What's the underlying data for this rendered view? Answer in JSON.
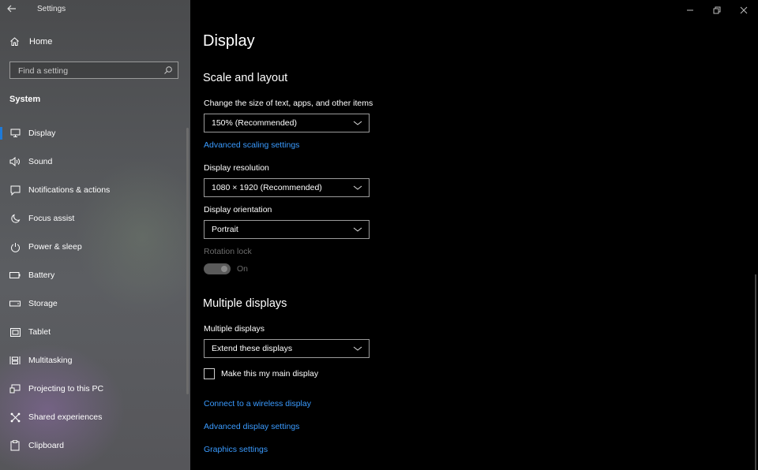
{
  "window": {
    "title": "Settings"
  },
  "sidebar": {
    "home_label": "Home",
    "search_placeholder": "Find a setting",
    "section": "System",
    "items": [
      {
        "label": "Display",
        "icon": "monitor-icon"
      },
      {
        "label": "Sound",
        "icon": "speaker-icon"
      },
      {
        "label": "Notifications & actions",
        "icon": "notification-icon"
      },
      {
        "label": "Focus assist",
        "icon": "moon-icon"
      },
      {
        "label": "Power & sleep",
        "icon": "power-icon"
      },
      {
        "label": "Battery",
        "icon": "battery-icon"
      },
      {
        "label": "Storage",
        "icon": "storage-icon"
      },
      {
        "label": "Tablet",
        "icon": "tablet-icon"
      },
      {
        "label": "Multitasking",
        "icon": "multitasking-icon"
      },
      {
        "label": "Projecting to this PC",
        "icon": "projecting-icon"
      },
      {
        "label": "Shared experiences",
        "icon": "shared-icon"
      },
      {
        "label": "Clipboard",
        "icon": "clipboard-icon"
      }
    ],
    "active_index": 0
  },
  "main": {
    "title": "Display",
    "scale": {
      "heading": "Scale and layout",
      "size_label": "Change the size of text, apps, and other items",
      "size_value": "150% (Recommended)",
      "advanced_link": "Advanced scaling settings",
      "resolution_label": "Display resolution",
      "resolution_value": "1080 × 1920 (Recommended)",
      "orientation_label": "Display orientation",
      "orientation_value": "Portrait",
      "rotation_label": "Rotation lock",
      "rotation_state": "On"
    },
    "multiple": {
      "heading": "Multiple displays",
      "label": "Multiple displays",
      "value": "Extend these displays",
      "main_display_label": "Make this my main display",
      "main_display_checked": false,
      "links": [
        "Connect to a wireless display",
        "Advanced display settings",
        "Graphics settings"
      ]
    }
  },
  "colors": {
    "accent": "#1e7ad9",
    "link": "#3a9bff",
    "background": "#000000"
  }
}
